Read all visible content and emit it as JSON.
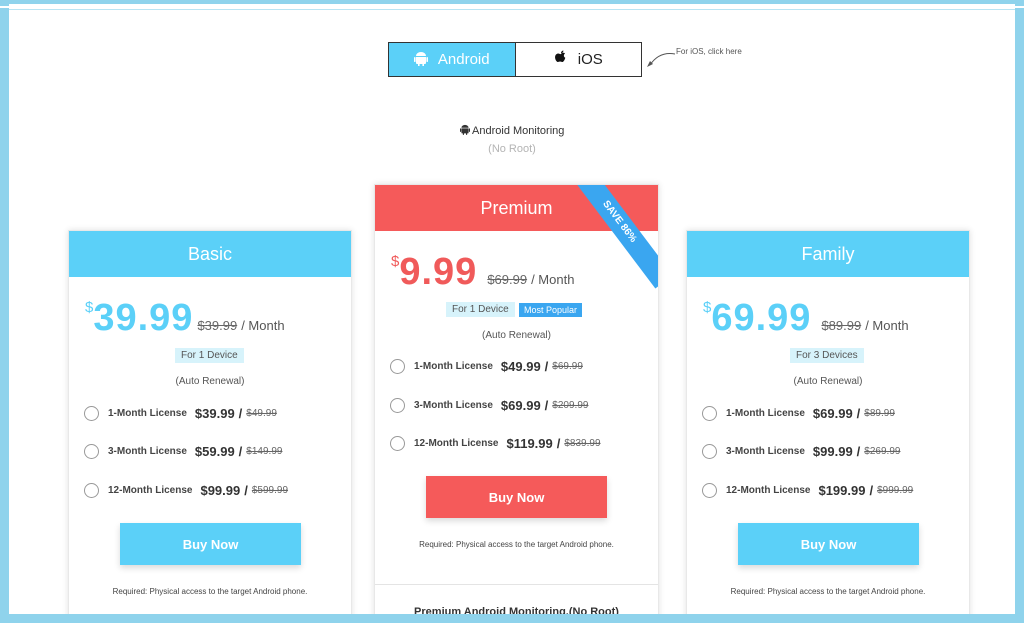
{
  "platform_toggle": {
    "android_label": "Android",
    "ios_label": "iOS",
    "hint": "For iOS, click here"
  },
  "monitoring": {
    "title": "Android Monitoring",
    "subtitle": "(No Root)"
  },
  "plans": {
    "basic": {
      "name": "Basic",
      "currency": "$",
      "price": "39.99",
      "old_price": "$39.99",
      "period": "/ Month",
      "devices": "For 1 Device",
      "renewal": "(Auto Renewal)",
      "options": [
        {
          "label": "1-Month License",
          "price": "$39.99",
          "old": "$49.99"
        },
        {
          "label": "3-Month License",
          "price": "$59.99",
          "old": "$149.99"
        },
        {
          "label": "12-Month License",
          "price": "$99.99",
          "old": "$599.99"
        }
      ],
      "buy_label": "Buy Now",
      "requirement": "Required: Physical access to the target Android phone."
    },
    "premium": {
      "name": "Premium",
      "ribbon": "SAVE 86%",
      "currency": "$",
      "price": "9.99",
      "old_price": "$69.99",
      "period": "/ Month",
      "devices": "For 1 Device",
      "popular": "Most Popular",
      "renewal": "(Auto Renewal)",
      "options": [
        {
          "label": "1-Month License",
          "price": "$49.99",
          "old": "$69.99"
        },
        {
          "label": "3-Month License",
          "price": "$69.99",
          "old": "$209.99"
        },
        {
          "label": "12-Month License",
          "price": "$119.99",
          "old": "$839.99"
        }
      ],
      "buy_label": "Buy Now",
      "requirement": "Required: Physical access to the target Android phone.",
      "footer": "Premium Android Monitoring.(No Root)"
    },
    "family": {
      "name": "Family",
      "currency": "$",
      "price": "69.99",
      "old_price": "$89.99",
      "period": "/ Month",
      "devices": "For 3 Devices",
      "renewal": "(Auto Renewal)",
      "options": [
        {
          "label": "1-Month License",
          "price": "$69.99",
          "old": "$89.99"
        },
        {
          "label": "3-Month License",
          "price": "$99.99",
          "old": "$269.99"
        },
        {
          "label": "12-Month License",
          "price": "$199.99",
          "old": "$999.99"
        }
      ],
      "buy_label": "Buy Now",
      "requirement": "Required: Physical access to the target Android phone."
    }
  },
  "colors": {
    "accent_blue": "#5bd0f8",
    "accent_red": "#f55a5a",
    "ribbon_blue": "#3aa6f0"
  }
}
